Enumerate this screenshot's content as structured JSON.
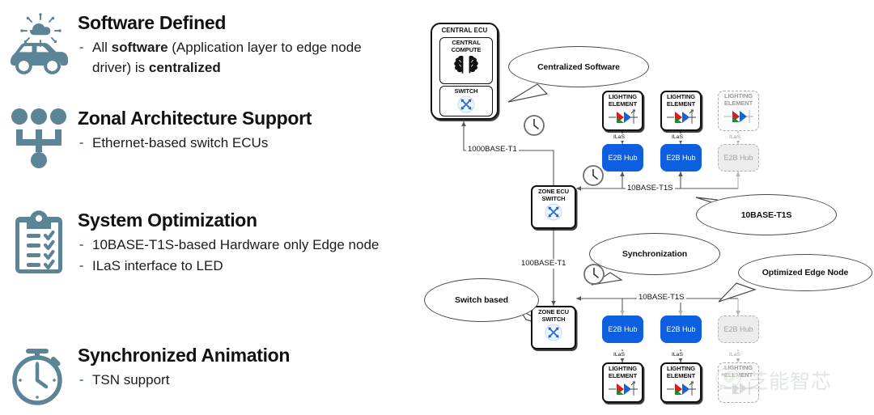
{
  "theme": {
    "icon_teal": "#5b8496",
    "hub_blue": "#0d5fe0",
    "dim_gray": "#a3a3a3",
    "led_red": "#d21f1f",
    "led_green": "#12912b",
    "led_blue": "#1763d6",
    "text_black": "#111111"
  },
  "features": [
    {
      "icon": "connected-car-icon",
      "title": "Software Defined",
      "bullets": [
        {
          "dash": "-",
          "segments": [
            {
              "text": "All ",
              "bold": false
            },
            {
              "text": "software",
              "bold": true
            },
            {
              "text": " (Application layer to edge node driver) is ",
              "bold": false
            },
            {
              "text": "centralized",
              "bold": true
            }
          ]
        }
      ]
    },
    {
      "icon": "network-topology-icon",
      "title": "Zonal Architecture Support",
      "bullets": [
        {
          "dash": "-",
          "segments": [
            {
              "text": "Ethernet-based switch ECUs",
              "bold": false
            }
          ]
        }
      ]
    },
    {
      "icon": "clipboard-checklist-icon",
      "title": "System Optimization",
      "bullets": [
        {
          "dash": "-",
          "segments": [
            {
              "text": "10BASE-T1S-based Hardware only Edge node",
              "bold": false
            }
          ]
        },
        {
          "dash": "-",
          "segments": [
            {
              "text": "ILaS interface to LED",
              "bold": false
            }
          ]
        }
      ]
    },
    {
      "icon": "stopwatch-icon",
      "title": "Synchronized Animation",
      "bullets": [
        {
          "dash": "-",
          "segments": [
            {
              "text": "TSN support",
              "bold": false
            }
          ]
        }
      ]
    }
  ],
  "diagram": {
    "central_ecu": {
      "title": "CENTRAL ECU",
      "compute": {
        "label": "CENTRAL\nCOMPUTE",
        "icon": "brain-icon"
      },
      "switch": {
        "label": "SWITCH",
        "icon": "switch-icon"
      }
    },
    "zone_ecu_top": {
      "label": "ZONE ECU\nSWITCH",
      "icon": "switch-icon"
    },
    "zone_ecu_bottom": {
      "label": "ZONE ECU\nSWITCH",
      "icon": "switch-icon"
    },
    "lighting_label": "LIGHTING\nELEMENT",
    "hub_label": "E2B Hub",
    "ilas_label": "ILaS",
    "links": {
      "central_to_zone": "1000BASE-T1",
      "zone_to_zone": "100BASE-T1",
      "top_edge_bus": "10BASE-T1S",
      "bottom_edge_bus": "10BASE-T1S"
    },
    "callouts": [
      {
        "name": "centralized-software",
        "text": "Centralized Software"
      },
      {
        "name": "ten-base-t1s",
        "text": "10BASE-T1S"
      },
      {
        "name": "synchronization",
        "text": "Synchronization"
      },
      {
        "name": "optimized-edge-node",
        "text": "Optimized Edge Node"
      },
      {
        "name": "switch-based",
        "text": "Switch based"
      }
    ],
    "clocks": [
      "clock-icon",
      "clock-icon",
      "clock-icon"
    ],
    "top_row": [
      {
        "state": "active"
      },
      {
        "state": "active"
      },
      {
        "state": "inactive"
      }
    ],
    "bottom_row": [
      {
        "state": "active"
      },
      {
        "state": "active"
      },
      {
        "state": "inactive"
      }
    ]
  },
  "watermark": {
    "text": "芝能智芯",
    "logo": "chat-bubble-logo"
  }
}
